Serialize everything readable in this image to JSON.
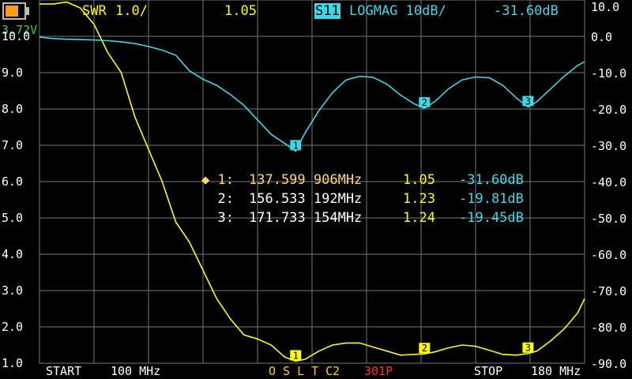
{
  "header": {
    "trace1_name": "SWR",
    "trace1_scale": "1.0/",
    "trace1_value": "1.05",
    "trace2_name": "S11",
    "trace2_format": "LOGMAG 10dB/",
    "trace2_value": "-31.60dB"
  },
  "battery": {
    "voltage": "3.72V",
    "level": 0.65
  },
  "left_axis": [
    "10.0",
    "9.0",
    "8.0",
    "7.0",
    "6.0",
    "5.0",
    "4.0",
    "3.0",
    "2.0",
    "1.0"
  ],
  "right_axis": [
    "10.0",
    "0.0",
    "-10.0",
    "-20.0",
    "-30.0",
    "-40.0",
    "-50.0",
    "-60.0",
    "-70.0",
    "-80.0",
    "-90.0"
  ],
  "markers": [
    {
      "label": "◆ 1:",
      "freq": "137.599 906MHz",
      "swr": "1.05",
      "db": "-31.60dB"
    },
    {
      "label": "  2:",
      "freq": "156.533 192MHz",
      "swr": "1.23",
      "db": "-19.81dB"
    },
    {
      "label": "  3:",
      "freq": "171.733 154MHz",
      "swr": "1.24",
      "db": "-19.45dB"
    }
  ],
  "footer": {
    "start_label": "START",
    "start_value": "100 MHz",
    "cal": "O S L T",
    "cal_slot": "C2",
    "points": "301P",
    "stop_label": "STOP",
    "stop_value": "180 MHz"
  },
  "chart_data": {
    "type": "line",
    "x": [
      100,
      102,
      104,
      106,
      108,
      110,
      112,
      114,
      116,
      118,
      120,
      122,
      124,
      126,
      128,
      130,
      132,
      134,
      136,
      137.6,
      139,
      141,
      143,
      145,
      147,
      149,
      151,
      153,
      155,
      156.5,
      158,
      160,
      162,
      164,
      166,
      168,
      170,
      171.7,
      173,
      175,
      177,
      179,
      180
    ],
    "series": [
      {
        "name": "SWR",
        "axis": "left",
        "ylim": [
          1,
          10
        ],
        "values": [
          9.9,
          9.9,
          9.95,
          9.8,
          9.4,
          8.7,
          8.2,
          7.1,
          6.3,
          5.5,
          4.5,
          4.0,
          3.3,
          2.6,
          2.1,
          1.7,
          1.6,
          1.45,
          1.15,
          1.05,
          1.1,
          1.3,
          1.45,
          1.5,
          1.5,
          1.4,
          1.3,
          1.2,
          1.22,
          1.23,
          1.28,
          1.38,
          1.45,
          1.42,
          1.32,
          1.22,
          1.2,
          1.24,
          1.3,
          1.55,
          1.85,
          2.25,
          2.6
        ]
      },
      {
        "name": "S11",
        "axis": "right",
        "ylim": [
          -90,
          10
        ],
        "values": [
          -0.2,
          -0.6,
          -0.8,
          -0.9,
          -1.0,
          -1.2,
          -1.5,
          -2.0,
          -2.8,
          -3.8,
          -5.2,
          -9.5,
          -11.8,
          -13.5,
          -16.0,
          -19.0,
          -23.0,
          -27.0,
          -29.5,
          -31.6,
          -26.5,
          -20.5,
          -15.5,
          -12.0,
          -11.0,
          -11.3,
          -13.2,
          -16.2,
          -18.6,
          -19.8,
          -18.0,
          -14.5,
          -12.0,
          -11.2,
          -11.4,
          -13.5,
          -17.0,
          -19.45,
          -18.0,
          -14.5,
          -11.0,
          -8.0,
          -7.0
        ]
      }
    ],
    "marker_x": [
      137.6,
      156.5,
      171.7
    ]
  }
}
